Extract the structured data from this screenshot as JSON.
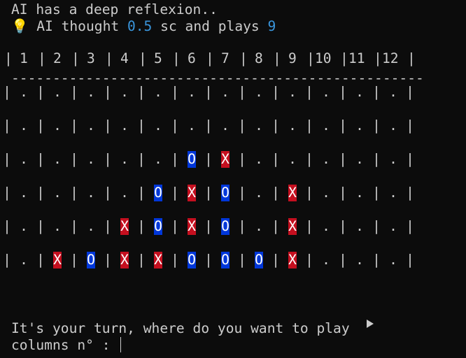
{
  "status_line": "AI has a deep reflexion..",
  "thought": {
    "icon": "lightbulb-icon",
    "prefix": "AI thought ",
    "seconds": "0.5",
    "middle": " sc and plays ",
    "column": "9"
  },
  "board": {
    "column_headers": [
      "1",
      "2",
      "3",
      "4",
      "5",
      "6",
      "7",
      "8",
      "9",
      "10",
      "11",
      "12"
    ],
    "divider": "--------------------------------------------------",
    "empty_symbol": ".",
    "rows": [
      [
        "",
        "",
        "",
        "",
        "",
        "",
        "",
        "",
        "",
        "",
        "",
        ""
      ],
      [
        "",
        "",
        "",
        "",
        "",
        "",
        "",
        "",
        "",
        "",
        "",
        ""
      ],
      [
        "",
        "",
        "",
        "",
        "",
        "O",
        "X",
        "",
        "",
        "",
        "",
        ""
      ],
      [
        "",
        "",
        "",
        "",
        "O",
        "X",
        "O",
        "",
        "X",
        "",
        "",
        ""
      ],
      [
        "",
        "",
        "",
        "X",
        "O",
        "X",
        "O",
        "",
        "X",
        "",
        "",
        ""
      ],
      [
        "",
        "X",
        "O",
        "X",
        "X",
        "O",
        "O",
        "O",
        "X",
        "",
        "",
        ""
      ]
    ],
    "colors": {
      "X": "#c50f1f",
      "O": "#0037da"
    }
  },
  "prompt": {
    "line1": "It's your turn, where do you want to play",
    "arrow_icon": "play-arrow-icon",
    "line2": "columns n° : "
  }
}
